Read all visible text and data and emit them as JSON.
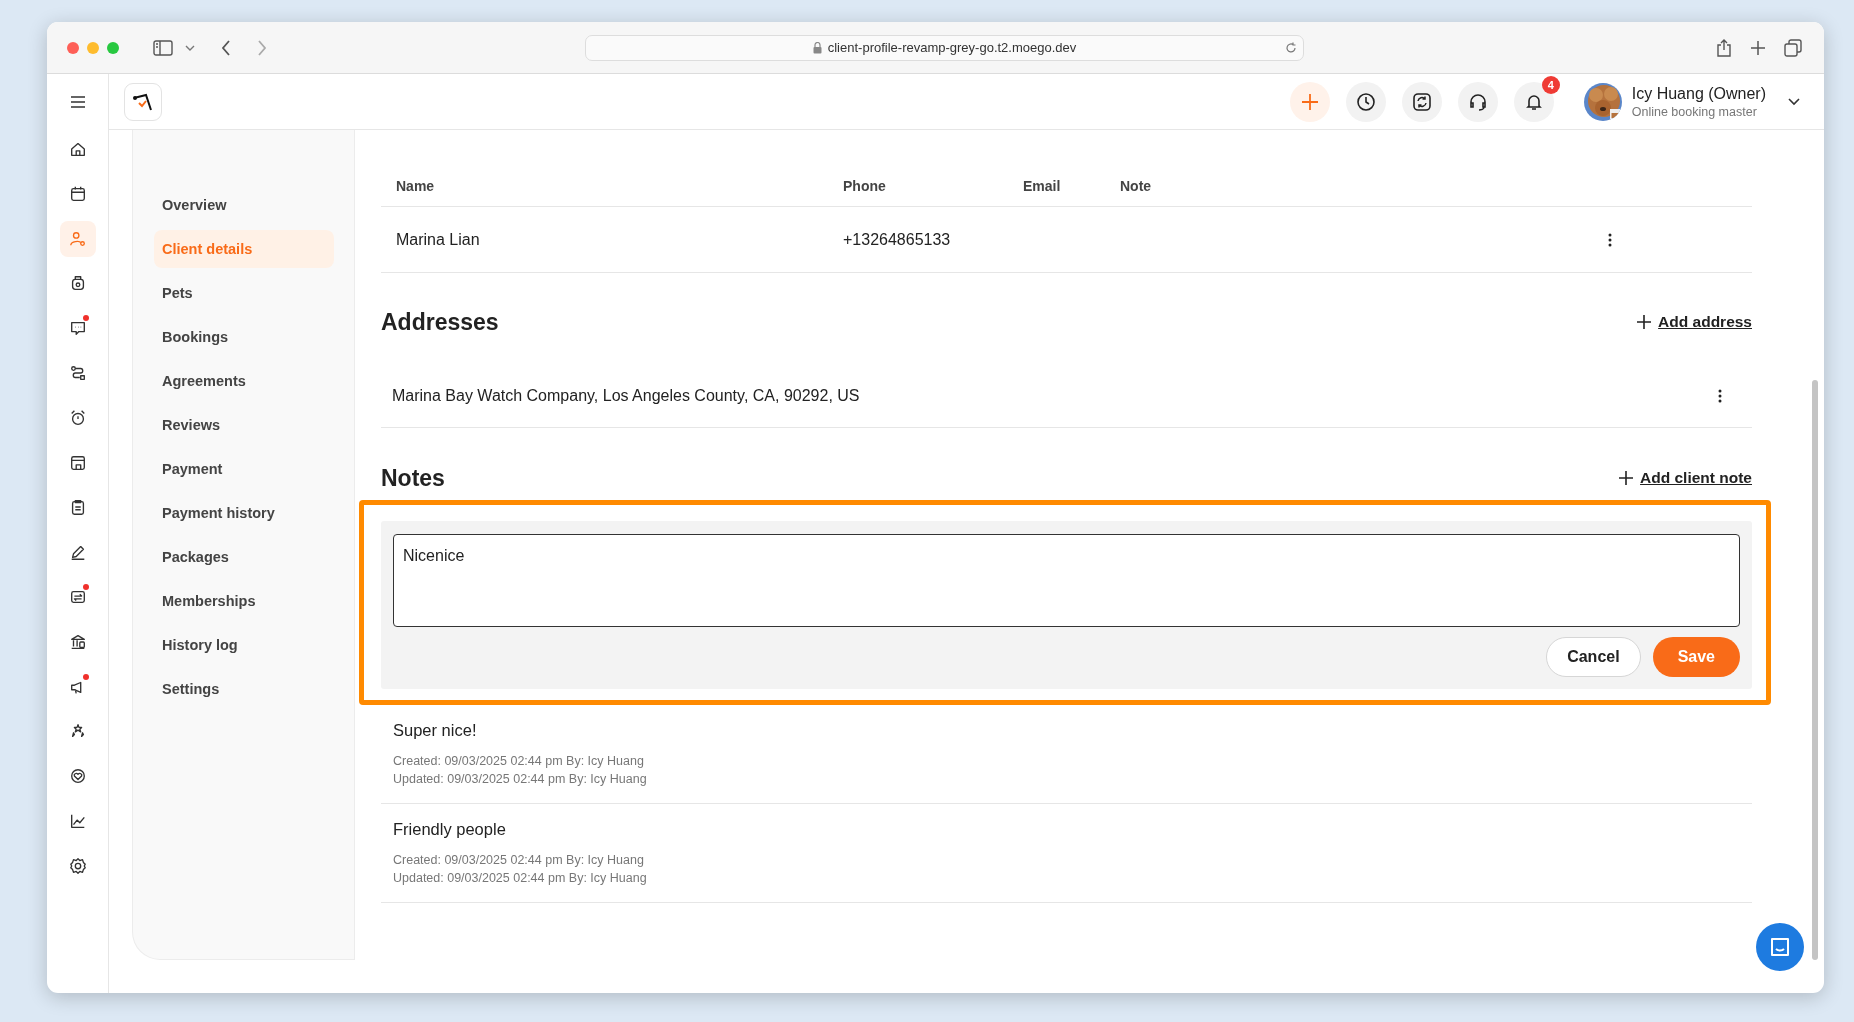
{
  "browser": {
    "url": "client-profile-revamp-grey-go.t2.moego.dev"
  },
  "header": {
    "notification_count": "4",
    "user": {
      "name": "Icy Huang (Owner)",
      "role": "Online booking master"
    }
  },
  "rail": [
    {
      "selected": false,
      "badge": false
    },
    {
      "selected": false,
      "badge": false
    },
    {
      "selected": true,
      "badge": false
    },
    {
      "selected": false,
      "badge": false
    },
    {
      "selected": false,
      "badge": true
    },
    {
      "selected": false,
      "badge": false
    },
    {
      "selected": false,
      "badge": false
    },
    {
      "selected": false,
      "badge": false
    },
    {
      "selected": false,
      "badge": false
    },
    {
      "selected": false,
      "badge": false
    },
    {
      "selected": false,
      "badge": true
    },
    {
      "selected": false,
      "badge": false
    },
    {
      "selected": false,
      "badge": true
    },
    {
      "selected": false,
      "badge": false
    },
    {
      "selected": false,
      "badge": false
    },
    {
      "selected": false,
      "badge": false
    },
    {
      "selected": false,
      "badge": false
    }
  ],
  "sidebar": {
    "items": [
      {
        "label": "Overview",
        "selected": false
      },
      {
        "label": "Client details",
        "selected": true
      },
      {
        "label": "Pets",
        "selected": false
      },
      {
        "label": "Bookings",
        "selected": false
      },
      {
        "label": "Agreements",
        "selected": false
      },
      {
        "label": "Reviews",
        "selected": false
      },
      {
        "label": "Payment",
        "selected": false
      },
      {
        "label": "Payment history",
        "selected": false
      },
      {
        "label": "Packages",
        "selected": false
      },
      {
        "label": "Memberships",
        "selected": false
      },
      {
        "label": "History log",
        "selected": false
      },
      {
        "label": "Settings",
        "selected": false
      }
    ]
  },
  "contacts": {
    "columns": [
      "Name",
      "Phone",
      "Email",
      "Note"
    ],
    "rows": [
      {
        "name": "Marina Lian",
        "phone": "+13264865133"
      }
    ]
  },
  "addresses": {
    "title": "Addresses",
    "add_label": "Add address",
    "items": [
      "Marina Bay Watch Company, Los Angeles County, CA, 90292, US"
    ]
  },
  "notes": {
    "title": "Notes",
    "add_label": "Add client note",
    "editor": {
      "value": "Nicenice",
      "cancel": "Cancel",
      "save": "Save"
    },
    "items": [
      {
        "text": "Super nice!",
        "created": "Created: 09/03/2025 02:44 pm By: Icy Huang",
        "updated": "Updated: 09/03/2025 02:44 pm By: Icy Huang"
      },
      {
        "text": "Friendly people",
        "created": "Created: 09/03/2025 02:44 pm By: Icy Huang",
        "updated": "Updated: 09/03/2025 02:44 pm By: Icy Huang"
      }
    ]
  }
}
